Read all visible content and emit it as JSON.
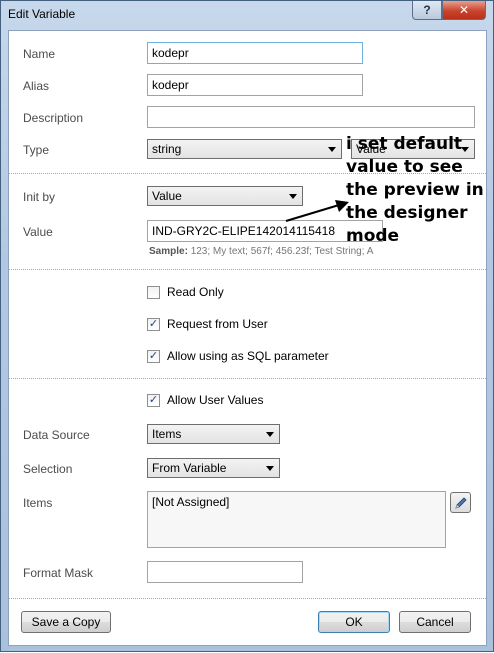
{
  "window": {
    "title": "Edit Variable",
    "help_label": "?",
    "close_label": "✕"
  },
  "fields": {
    "name_label": "Name",
    "name_value": "kodepr",
    "alias_label": "Alias",
    "alias_value": "kodepr",
    "description_label": "Description",
    "description_value": "",
    "type_label": "Type",
    "type_value": "string",
    "type_kind_value": "Value",
    "init_by_label": "Init by",
    "init_by_value": "Value",
    "value_label": "Value",
    "value_value": "IND-GRY2C-ELIPE142014115418",
    "sample_label": "Sample:",
    "sample_text": "123; My text; 567f; 456.23f; Test String; A"
  },
  "checkboxes": {
    "read_only": {
      "label": "Read Only",
      "checked": false
    },
    "request_from_user": {
      "label": "Request from User",
      "checked": true
    },
    "allow_sql": {
      "label": "Allow using as SQL parameter",
      "checked": true
    },
    "allow_user_values": {
      "label": "Allow User Values",
      "checked": true
    }
  },
  "data_source": {
    "data_source_label": "Data Source",
    "data_source_value": "Items",
    "selection_label": "Selection",
    "selection_value": "From Variable",
    "items_label": "Items",
    "items_value": "[Not Assigned]",
    "format_mask_label": "Format Mask",
    "format_mask_value": ""
  },
  "buttons": {
    "save_copy": "Save a Copy",
    "ok": "OK",
    "cancel": "Cancel"
  },
  "annotation": {
    "text": "i set default\nvalue to see\nthe preview in\nthe designer\nmode"
  },
  "colors": {
    "title_bar": "#b9cde5",
    "close_button": "#c8442d",
    "checkmark": "#22408a",
    "focus_border": "#6fb2e0"
  }
}
